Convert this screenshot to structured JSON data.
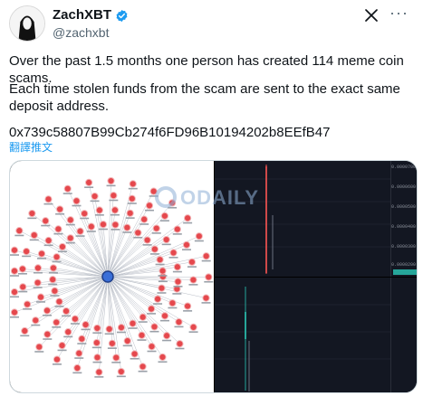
{
  "author": {
    "name": "ZachXBT",
    "handle": "@zachxbt"
  },
  "tweet": {
    "line1": "Over the past 1.5 months one person has created 114 meme coin scams.",
    "line2": "Each time stolen funds from the scam are sent to the exact same",
    "line3": "deposit address.",
    "address": "0x739c58807B99Cb274f6FD96B10194202b8EEfB47",
    "translate_label": "翻譯推文"
  },
  "media": {
    "watermark": "ODAILY",
    "graph_node_count": 114,
    "chart_top_ticks": [
      "0.0000700",
      "0.0000600",
      "0.0000500",
      "0.0000400",
      "0.0000300",
      "0.0000200"
    ],
    "chart_bottom_ticks": []
  },
  "colors": {
    "verified": "#1d9bf0",
    "node": "#e5484d",
    "chart_bg": "#131722",
    "candle_green": "#26a69a",
    "candle_red": "#ef5350"
  },
  "icons": {
    "verified": "verified-badge-icon",
    "x_logo": "x-logo-icon",
    "more": "more-options-icon"
  }
}
